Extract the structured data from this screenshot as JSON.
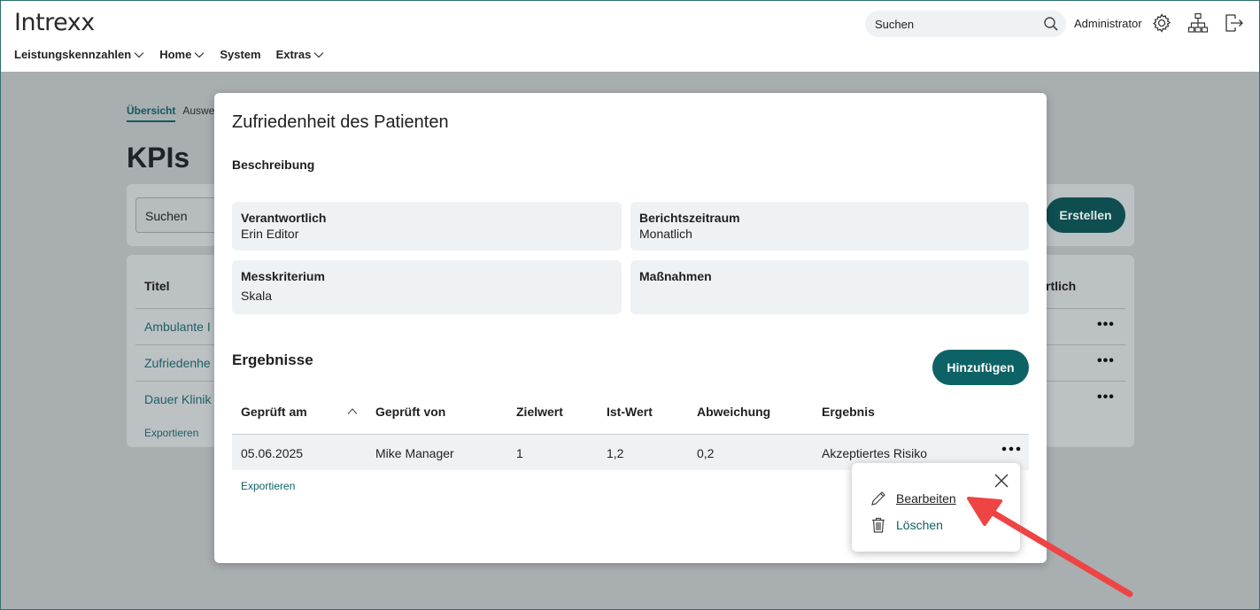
{
  "app": {
    "logo": "Intrexx",
    "nav": [
      "Leistungskennzahlen",
      "Home",
      "System",
      "Extras"
    ],
    "search_placeholder": "Suchen",
    "user": "Administrator"
  },
  "background": {
    "tabs": [
      "Übersicht",
      "Auswe"
    ],
    "title": "KPIs",
    "search_placeholder": "Suchen",
    "create_label": "Erstellen",
    "col_title": "Titel",
    "col_right": "rtlich",
    "rows": [
      "Ambulante I",
      "Zufriedenhe",
      "Dauer Klinik"
    ],
    "export": "Exportieren"
  },
  "modal": {
    "title": "Zufriedenheit des Patienten",
    "description_label": "Beschreibung",
    "fields": [
      {
        "label": "Verantwortlich",
        "value": "Erin Editor"
      },
      {
        "label": "Berichtszeitraum",
        "value": "Monatlich"
      },
      {
        "label": "Messkriterium",
        "value": "Skala"
      },
      {
        "label": "Maßnahmen",
        "value": ""
      }
    ],
    "results_title": "Ergebnisse",
    "add_label": "Hinzufügen",
    "columns": [
      "Geprüft am",
      "Geprüft von",
      "Zielwert",
      "Ist-Wert",
      "Abweichung",
      "Ergebnis"
    ],
    "row": [
      "05.06.2025",
      "Mike Manager",
      "1",
      "1,2",
      "0,2",
      "Akzeptiertes Risiko"
    ],
    "export": "Exportieren"
  },
  "menu": {
    "edit": "Bearbeiten",
    "delete": "Löschen"
  },
  "colors": {
    "accent": "#0d6266",
    "annotation_arrow": "#ef4444"
  }
}
